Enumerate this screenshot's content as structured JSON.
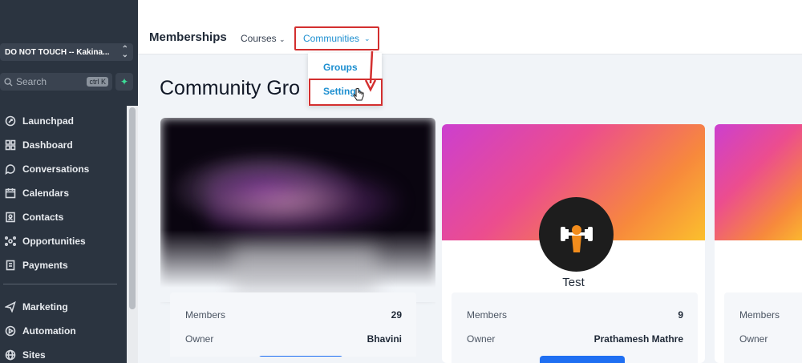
{
  "sidebar": {
    "account": "DO NOT TOUCH -- Kakina...",
    "search_placeholder": "Search",
    "search_shortcut": "ctrl K",
    "items": [
      {
        "label": "Launchpad",
        "icon": "rocket-icon"
      },
      {
        "label": "Dashboard",
        "icon": "grid-icon"
      },
      {
        "label": "Conversations",
        "icon": "chat-icon"
      },
      {
        "label": "Calendars",
        "icon": "calendar-icon"
      },
      {
        "label": "Contacts",
        "icon": "contacts-icon"
      },
      {
        "label": "Opportunities",
        "icon": "opportunities-icon"
      },
      {
        "label": "Payments",
        "icon": "payments-icon"
      }
    ],
    "items2": [
      {
        "label": "Marketing",
        "icon": "send-icon"
      },
      {
        "label": "Automation",
        "icon": "automation-icon"
      },
      {
        "label": "Sites",
        "icon": "globe-icon"
      }
    ]
  },
  "header": {
    "title": "Memberships",
    "courses": "Courses",
    "communities": "Communities"
  },
  "dropdown": {
    "groups": "Groups",
    "settings": "Settings"
  },
  "main": {
    "title": "Community Gro",
    "cards": [
      {
        "name": "",
        "members_label": "Members",
        "members": "29",
        "owner_label": "Owner",
        "owner": "Bhavini"
      },
      {
        "name": "Test",
        "members_label": "Members",
        "members": "9",
        "owner_label": "Owner",
        "owner": "Prathamesh Mathre"
      },
      {
        "name": "",
        "members_label": "Members",
        "members": "",
        "owner_label": "Owner",
        "owner": ""
      }
    ]
  },
  "colors": {
    "sidebar_bg": "#2b3440",
    "accent": "#1d8fd0",
    "highlight": "#d32f2f",
    "button": "#1f6ff2"
  }
}
